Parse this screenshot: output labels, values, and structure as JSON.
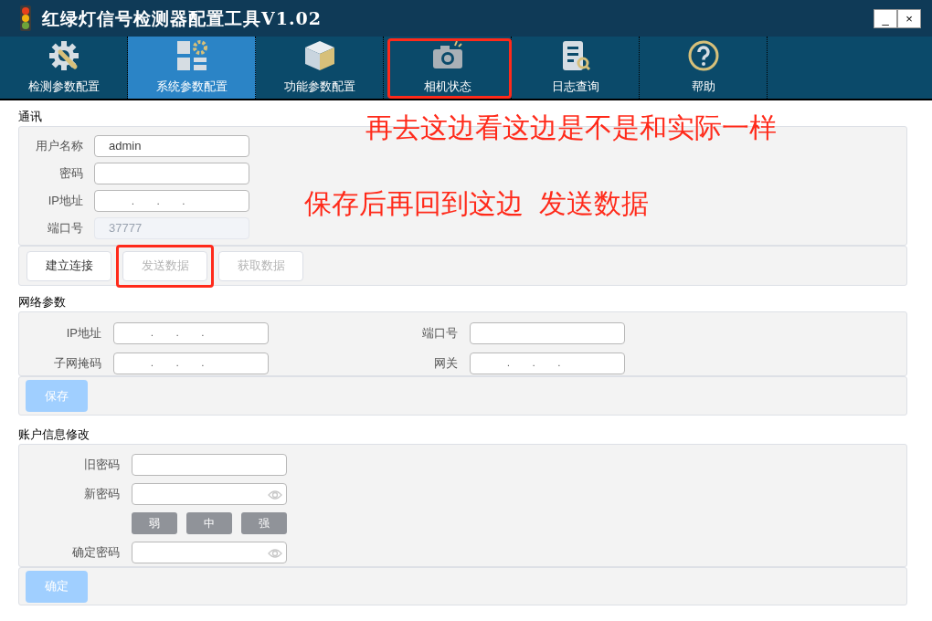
{
  "window": {
    "title": "红绿灯信号检测器配置工具V1.02",
    "controls": [
      "_",
      "×"
    ]
  },
  "tabs": [
    {
      "label": "检测参数配置",
      "selected": false,
      "annotated": false
    },
    {
      "label": "系统参数配置",
      "selected": true,
      "annotated": false
    },
    {
      "label": "功能参数配置",
      "selected": false,
      "annotated": false
    },
    {
      "label": "相机状态",
      "selected": false,
      "annotated": true
    },
    {
      "label": "日志查询",
      "selected": false,
      "annotated": false
    },
    {
      "label": "帮助",
      "selected": false,
      "annotated": false
    }
  ],
  "communication": {
    "title": "通讯",
    "fields": [
      {
        "label": "用户名称",
        "kind": "text",
        "value": "admin",
        "disabled": false
      },
      {
        "label": "密码",
        "kind": "text",
        "disabled": false
      },
      {
        "label": "IP地址",
        "kind": "ip",
        "value": ".         .         .",
        "disabled": false
      },
      {
        "label": "端口号",
        "kind": "text",
        "value": "37777",
        "disabled": true
      }
    ],
    "buttons": [
      {
        "label": "建立连接",
        "disabled": false,
        "annotated": false
      },
      {
        "label": "发送数据",
        "disabled": true,
        "annotated": true
      },
      {
        "label": "获取数据",
        "disabled": true,
        "annotated": false
      }
    ]
  },
  "network": {
    "title": "网络参数",
    "fields": [
      {
        "label": "IP地址",
        "kind": "ip",
        "value": ".         .         ."
      },
      {
        "label": "端口号",
        "kind": "text"
      },
      {
        "label": "子网掩码",
        "kind": "ip",
        "value": ".         .         ."
      },
      {
        "label": "网关",
        "kind": "ip",
        "value": ".         .         ."
      }
    ],
    "button": {
      "label": "保存",
      "disabled": true
    }
  },
  "account": {
    "title": "账户信息修改",
    "fields": [
      {
        "label": "旧密码",
        "kind": "text"
      },
      {
        "label": "新密码",
        "kind": "password"
      },
      {
        "kind": "strength",
        "levels": [
          "弱",
          "中",
          "强"
        ]
      },
      {
        "label": "确定密码",
        "kind": "password"
      }
    ],
    "button": {
      "label": "确定",
      "disabled": true
    }
  },
  "annotations": [
    "再去这边看这边是不是和实际一样",
    "保存后再回到这边  发送数据"
  ]
}
